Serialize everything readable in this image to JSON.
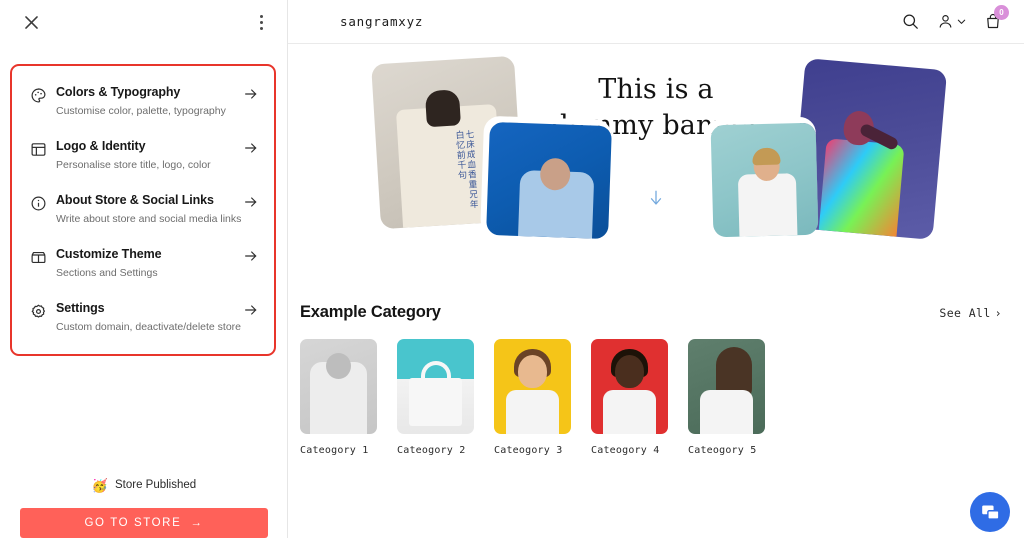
{
  "sidebar": {
    "close_icon": "close-icon",
    "more_icon": "kebab-menu-icon",
    "menu_items": [
      {
        "icon": "palette-icon",
        "title": "Colors & Typography",
        "subtitle": "Customise color, palette, typography"
      },
      {
        "icon": "layout-icon",
        "title": "Logo & Identity",
        "subtitle": "Personalise store title, logo, color"
      },
      {
        "icon": "info-circle-icon",
        "title": "About Store & Social Links",
        "subtitle": "Write about store and social media links"
      },
      {
        "icon": "storefront-icon",
        "title": "Customize Theme",
        "subtitle": "Sections and Settings"
      },
      {
        "icon": "gear-icon",
        "title": "Settings",
        "subtitle": "Custom domain, deactivate/delete store"
      }
    ],
    "footer": {
      "status_emoji": "🥳",
      "status_label": "Store Published",
      "cta_label": "GO TO STORE",
      "cta_arrow": "→",
      "cta_color": "#ff6159"
    },
    "highlight_color": "#e8352b"
  },
  "preview": {
    "header": {
      "store_name": "sangramxyz",
      "search_icon": "search-icon",
      "account_icon": "user-account-icon",
      "account_chevron": "chevron-down-icon",
      "cart_icon": "shopping-bag-icon",
      "cart_count": "0",
      "cart_badge_color": "#d98fd9"
    },
    "banner": {
      "title_line_1": "This is a",
      "title_line_2": "dummy banner",
      "scroll_icon": "scroll-down-arrow-icon",
      "scroll_icon_color": "#74a9dd",
      "images": [
        {
          "name": "graphic-tee-model-card",
          "glyph": "七床成血香重兄年白忆前千句"
        },
        {
          "name": "blue-hoodie-model-card"
        },
        {
          "name": "white-tee-model-card"
        },
        {
          "name": "neon-portrait-card"
        }
      ]
    },
    "category_section": {
      "title": "Example Category",
      "see_all_label": "See All",
      "see_all_chevron": "›",
      "items": [
        {
          "label": "Cateogory 1",
          "image": "white-hoodie-thumbnail"
        },
        {
          "label": "Cateogory 2",
          "image": "tote-bag-thumbnail"
        },
        {
          "label": "Cateogory 3",
          "image": "yellow-portrait-thumbnail"
        },
        {
          "label": "Cateogory 4",
          "image": "red-portrait-thumbnail"
        },
        {
          "label": "Cateogory 5",
          "image": "green-portrait-thumbnail"
        }
      ]
    },
    "chat_widget": {
      "icon": "chat-bubble-icon",
      "color": "#2f6ce5"
    }
  }
}
